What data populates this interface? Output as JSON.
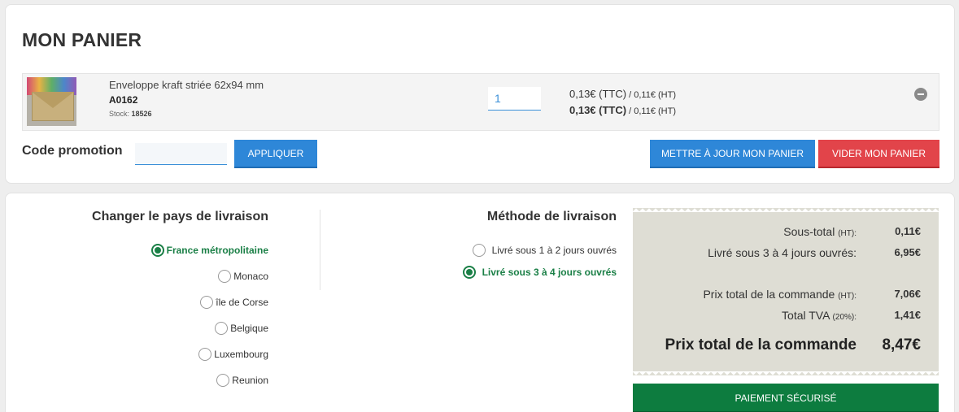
{
  "cart": {
    "title": "MON PANIER",
    "item": {
      "name": "Enveloppe kraft striée 62x94 mm",
      "ref": "A0162",
      "stock_label": "Stock:",
      "stock_value": "18526",
      "quantity": "1",
      "unit_price_ttc": "0,13€ (TTC)",
      "unit_price_sep": " / ",
      "unit_price_ht": "0,11€ (HT)",
      "total_price_ttc": "0,13€ (TTC)",
      "total_price_sep": " / ",
      "total_price_ht": "0,11€ (HT)"
    },
    "promo_label": "Code promotion",
    "promo_value": "",
    "apply_label": "APPLIQUER",
    "update_label": "METTRE À JOUR MON PANIER",
    "empty_label": "VIDER MON PANIER"
  },
  "shipping": {
    "country_title": "Changer le pays de livraison",
    "countries": [
      {
        "label": "France métropolitaine",
        "selected": true
      },
      {
        "label": "Monaco",
        "selected": false
      },
      {
        "label": "île de Corse",
        "selected": false
      },
      {
        "label": "Belgique",
        "selected": false
      },
      {
        "label": "Luxembourg",
        "selected": false
      },
      {
        "label": "Reunion",
        "selected": false
      }
    ],
    "method_title": "Méthode de livraison",
    "methods": [
      {
        "label": "Livré sous 1 à 2 jours ouvrés",
        "selected": false
      },
      {
        "label": "Livré sous 3 à 4 jours ouvrés",
        "selected": true
      }
    ]
  },
  "summary": {
    "subtotal_label": "Sous-total",
    "subtotal_unit": "(HT):",
    "subtotal_value": "0,11€",
    "shipping_label": "Livré sous 3 à 4 jours ouvrés:",
    "shipping_value": "6,95€",
    "order_total_ht_label": "Prix total de la commande",
    "order_total_ht_unit": "(HT):",
    "order_total_ht_value": "7,06€",
    "vat_label": "Total TVA",
    "vat_unit": "(20%):",
    "vat_value": "1,41€",
    "grand_total_label": "Prix total de la commande",
    "grand_total_value": "8,47€"
  },
  "payment_label": "PAIEMENT SÉCURISÉ",
  "colors": {
    "accent_blue": "#2e87d8",
    "danger_red": "#e2444a",
    "success_green": "#0d7c3f",
    "summary_bg": "#deddd4"
  }
}
